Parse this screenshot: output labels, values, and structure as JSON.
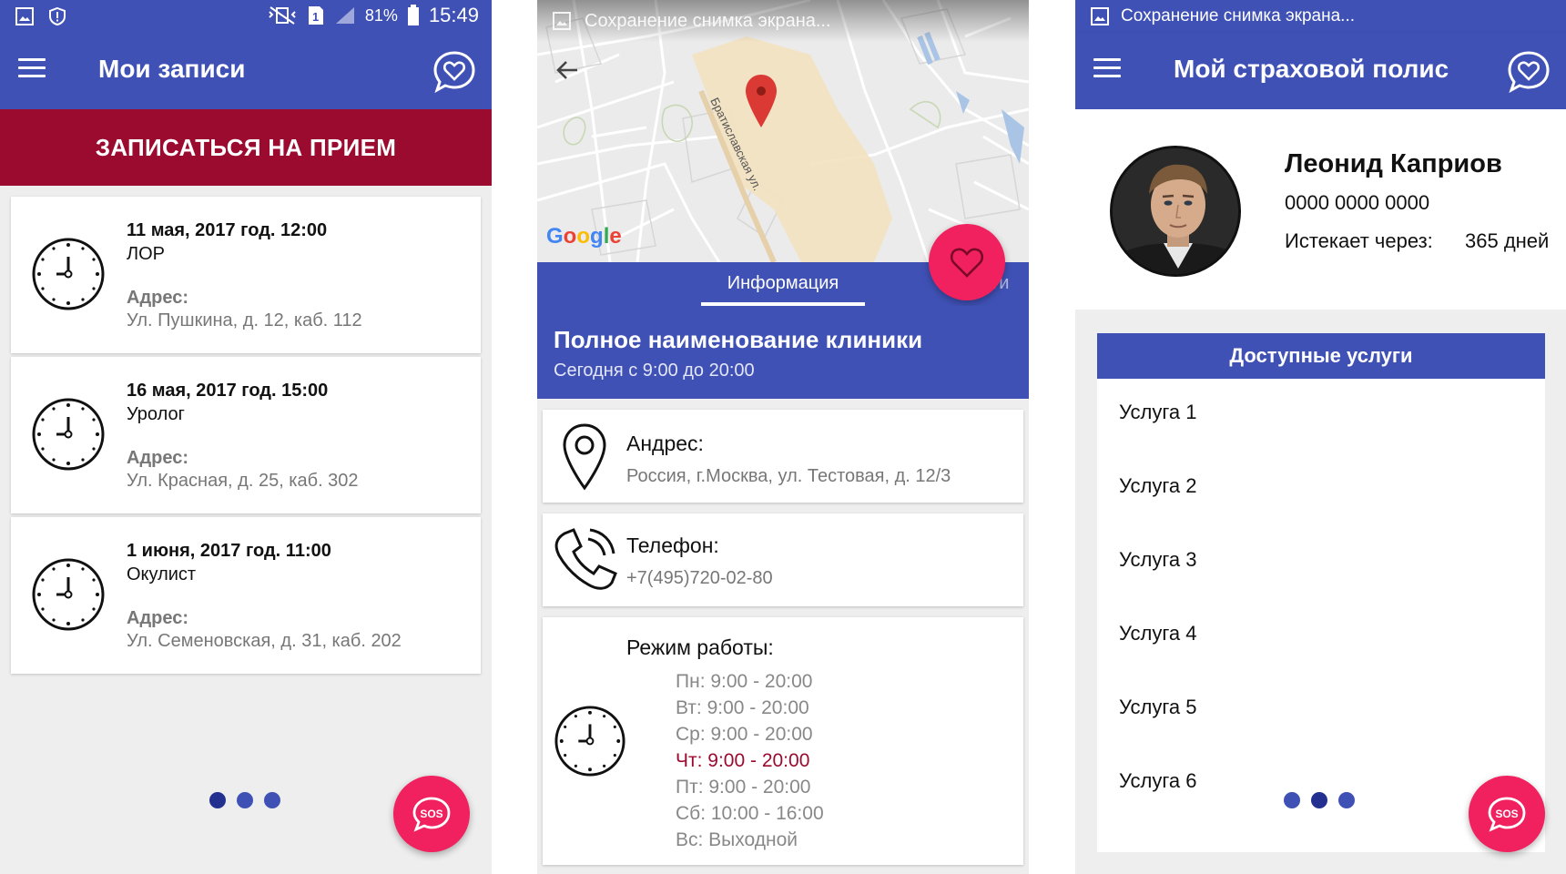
{
  "screen1": {
    "status": {
      "battery": "81%",
      "time": "15:49"
    },
    "title": "Мои записи",
    "cta": "ЗАПИСАТЬСЯ НА ПРИЕМ",
    "appointments": [
      {
        "datetime": "11 мая, 2017 год. 12:00",
        "specialty": "ЛОР",
        "address_label": "Адрес:",
        "address": "Ул. Пушкина, д. 12, каб. 112"
      },
      {
        "datetime": "16 мая, 2017 год. 15:00",
        "specialty": "Уролог",
        "address_label": "Адрес:",
        "address": "Ул. Красная, д. 25, каб. 302"
      },
      {
        "datetime": "1 июня, 2017 год. 11:00",
        "specialty": "Окулист",
        "address_label": "Адрес:",
        "address": "Ул. Семеновская, д. 31, каб. 202"
      }
    ],
    "sos": "SOS"
  },
  "screen2": {
    "status_text": "Сохранение снимка экрана...",
    "map_street": "Братиславская ул.",
    "google": "Google",
    "tabs": {
      "info": "Информация",
      "next": "уги"
    },
    "clinic": {
      "name": "Полное наименование клиники",
      "hours": "Сегодня с 9:00 до 20:00"
    },
    "address": {
      "label": "Андрес:",
      "value": "Россия, г.Москва, ул. Тестовая, д. 12/3"
    },
    "phone": {
      "label": "Телефон:",
      "value": "+7(495)720-02-80"
    },
    "schedule": {
      "label": "Режим работы:",
      "days": [
        "Пн: 9:00 - 20:00",
        "Вт: 9:00 - 20:00",
        "Ср: 9:00 - 20:00",
        "Чт: 9:00 - 20:00",
        "Пт: 9:00 - 20:00",
        "Сб: 10:00 - 16:00",
        "Вс: Выходной"
      ]
    }
  },
  "screen3": {
    "status_text": "Сохранение снимка экрана...",
    "title": "Мой страховой полис",
    "name": "Леонид Каприов",
    "policy_number": "0000 0000 0000",
    "expires_label": "Истекает через:",
    "expires_value": "365 дней",
    "services_title": "Доступные услуги",
    "services": [
      "Услуга 1",
      "Услуга 2",
      "Услуга 3",
      "Услуга 4",
      "Услуга 5",
      "Услуга 6"
    ],
    "sos": "SOS"
  },
  "colors": {
    "primary": "#3f51b5",
    "accent": "#f0215e",
    "cta": "#9b0a2f",
    "dot_active": "#23308f"
  }
}
